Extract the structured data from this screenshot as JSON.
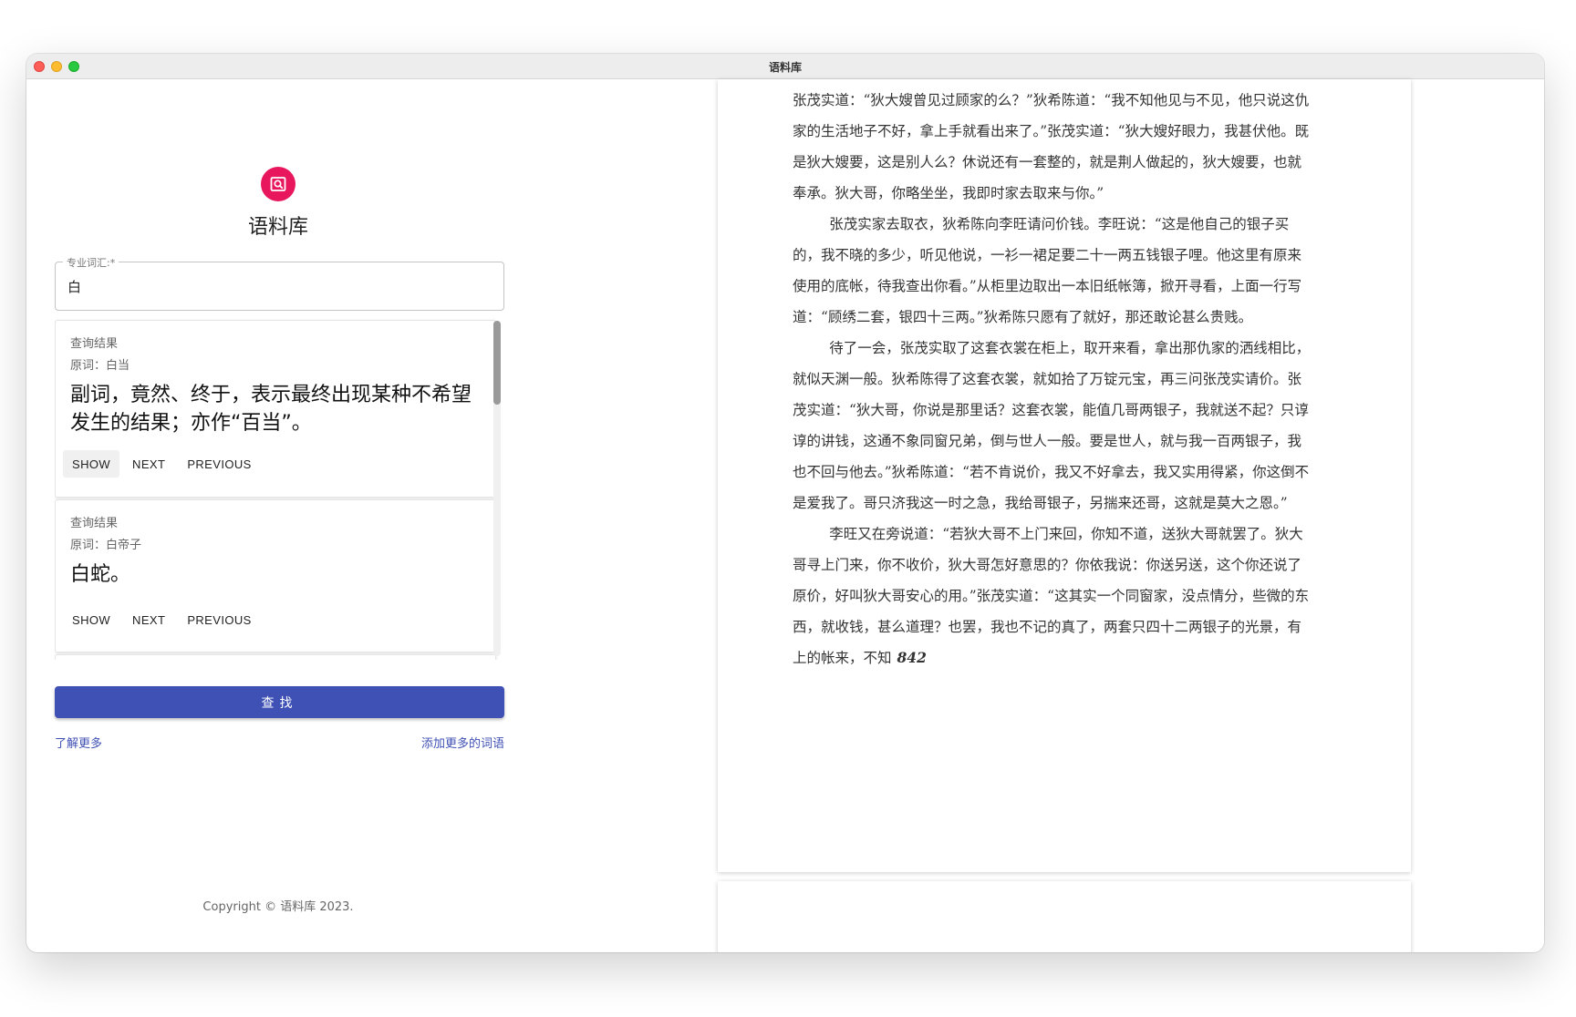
{
  "window": {
    "title": "语料库"
  },
  "app": {
    "logo_icon": "search-image-icon",
    "title": "语料库",
    "field_label": "专业词汇:*",
    "field_value": "白",
    "results": [
      {
        "caption": "查询结果",
        "original": "原词：白当",
        "definition": "副词，竟然、终于，表示最终出现某种不希望发生的结果；亦作“百当”。",
        "show": "SHOW",
        "next": "NEXT",
        "previous": "PREVIOUS"
      },
      {
        "caption": "查询结果",
        "original": "原词：白帝子",
        "definition": "白蛇。",
        "show": "SHOW",
        "next": "NEXT",
        "previous": "PREVIOUS"
      }
    ],
    "search_button": "查找",
    "learn_more": "了解更多",
    "add_more": "添加更多的词语",
    "copyright": "Copyright © 语料库 2023."
  },
  "document": {
    "paragraphs": [
      "张茂实道：“狄大嫂曾见过顾家的么？”狄希陈道：“我不知他见与不见，他只说这仇家的生活地子不好，拿上手就看出来了。”张茂实道：“狄大嫂好眼力，我甚伏他。既是狄大嫂要，这是别人么？休说还有一套整的，就是荆人做起的，狄大嫂要，也就奉承。狄大哥，你略坐坐，我即时家去取来与你。”",
      "张茂实家去取衣，狄希陈向李旺请问价钱。李旺说：“这是他自己的银子买的，我不晓的多少，听见他说，一衫一裙足要二十一两五钱银子哩。他这里有原来使用的底帐，待我查出你看。”从柜里边取出一本旧纸帐簿，掀开寻看，上面一行写道：“顾绣二套，银四十三两。”狄希陈只愿有了就好，那还敢论甚么贵贱。",
      "待了一会，张茂实取了这套衣裳在柜上，取开来看，拿出那仇家的洒线相比，就似天渊一般。狄希陈得了这套衣裳，就如拾了万锭元宝，再三问张茂实请价。张茂实道：“狄大哥，你说是那里话？这套衣裳，能值几哥两银子，我就送不起？只谆谆的讲钱，这通不象同窗兄弟，倒与世人一般。要是世人，就与我一百两银子，我也不回与他去。”狄希陈道：“若不肯说价，我又不好拿去，我又实用得紧，你这倒不是爱我了。哥只济我这一时之急，我给哥银子，另揣来还哥，这就是莫大之恩。”",
      "李旺又在旁说道：“若狄大哥不上门来回，你知不道，送狄大哥就罢了。狄大哥寻上门来，你不收价，狄大哥怎好意思的？你依我说：你送另送，这个你还说了原价，好叫狄大哥安心的用。”张茂实道：“这其实一个同窗家，没点情分，些微的东西，就收钱，甚么道理？也罢，我也不记的真了，两套只四十二两银子的光景，有上的帐来，不知"
    ],
    "page_number": "842"
  }
}
